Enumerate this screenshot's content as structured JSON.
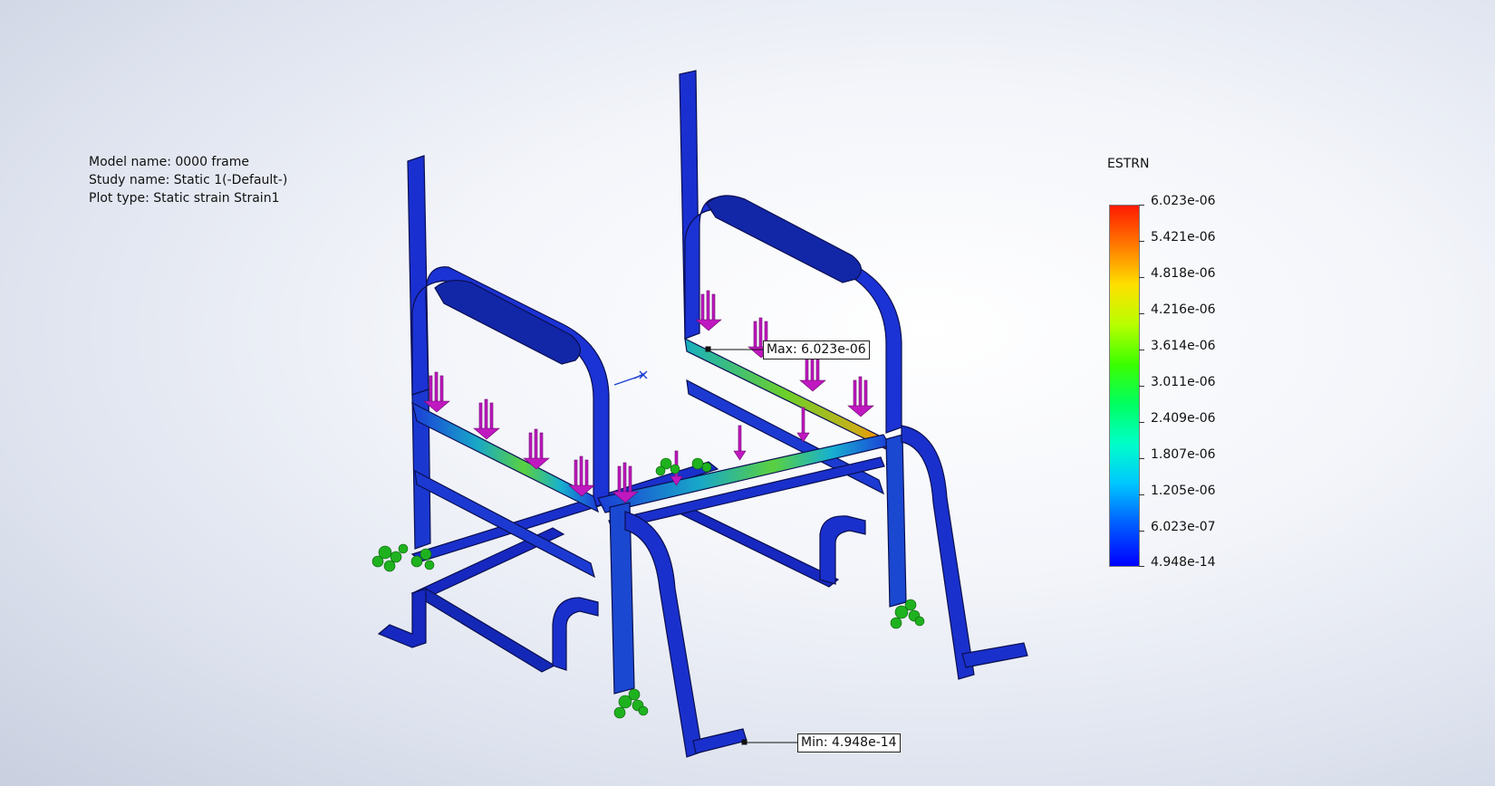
{
  "model_info": {
    "model_name": "Model name: 0000 frame",
    "study_name": "Study name: Static 1(-Default-)",
    "plot_type": "Plot type: Static strain Strain1"
  },
  "legend": {
    "title": "ESTRN",
    "labels": [
      "6.023e-06",
      "5.421e-06",
      "4.818e-06",
      "4.216e-06",
      "3.614e-06",
      "3.011e-06",
      "2.409e-06",
      "1.807e-06",
      "1.205e-06",
      "6.023e-07",
      "4.948e-14"
    ]
  },
  "callouts": {
    "max": "Max: 6.023e-06",
    "min": "Min: 4.948e-14"
  },
  "colors": {
    "frame": "#1a2fd0",
    "frame_edge": "#0a0f50",
    "load_arrows": "#c018c0",
    "fixtures": "#1fb21f",
    "high_strain": "#ff7a00"
  },
  "icons": {
    "triad": "coordinate-triad-icon",
    "load_arrow": "force-arrow-icon",
    "fixture": "fixed-geometry-icon"
  }
}
